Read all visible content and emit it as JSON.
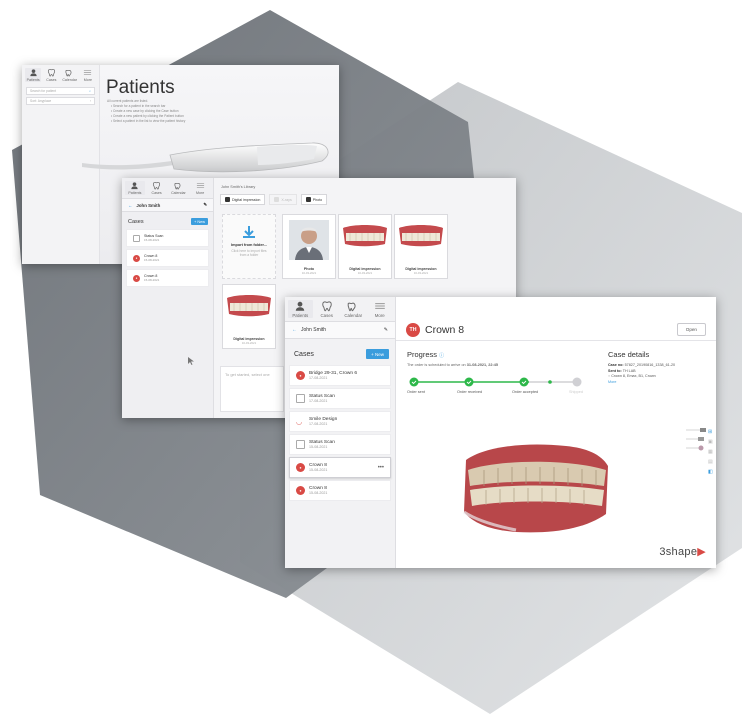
{
  "win1": {
    "title": "Patients",
    "tabs": [
      "Patients",
      "Cases",
      "Calendar",
      "More"
    ],
    "search_placeholder": "Search for patient",
    "sort_label": "Sort: Anyplace",
    "intro": "All current patients are listed.",
    "bullets": [
      "• Search for a patient in the search bar",
      "• Create a new case by clicking the Case button",
      "• Create a new patient by clicking the Patient button",
      "• Select a patient in the list to view the patient history"
    ]
  },
  "win2": {
    "tabs": [
      "Patients",
      "Cases",
      "Calendar",
      "More"
    ],
    "patient_name": "John Smith",
    "cases_heading": "Cases",
    "new_button": "+ New",
    "cases": [
      {
        "name": "Status Scan",
        "date": "15-08-2021",
        "type": "scan"
      },
      {
        "name": "Crown 8",
        "date": "15-08-2021",
        "type": "crown"
      },
      {
        "name": "Crown 8",
        "date": "15-08-2021",
        "type": "crown"
      }
    ],
    "library_title": "John Smith's Library",
    "filters": [
      {
        "label": "Digital impression",
        "on": true
      },
      {
        "label": "X-rays",
        "on": false
      },
      {
        "label": "Photo",
        "on": true
      }
    ],
    "import_title": "Import from folder...",
    "import_hint": "Click here to import files from a folder",
    "tiles": [
      {
        "label": "Photo",
        "date": "16-03-2021"
      },
      {
        "label": "Digital impression",
        "date": "16-03-2021"
      },
      {
        "label": "Digital impression",
        "date": "16-03-2021"
      },
      {
        "label": "Digital impression",
        "date": "16-03-2021"
      }
    ],
    "prompt": "To get started, select one"
  },
  "win3": {
    "tabs": [
      "Patients",
      "Cases",
      "Calendar",
      "More"
    ],
    "patient_name": "John Smith",
    "cases_heading": "Cases",
    "new_button": "+ New",
    "cases": [
      {
        "name": "Bridge 29-31, Crown 6",
        "date": "17-08-2021",
        "type": "crown"
      },
      {
        "name": "Status Scan",
        "date": "17-08-2021",
        "type": "scan"
      },
      {
        "name": "Smile Design",
        "date": "17-08-2021",
        "type": "smile"
      },
      {
        "name": "Status Scan",
        "date": "15-08-2021",
        "type": "scan"
      },
      {
        "name": "Crown 8",
        "date": "15-08-2021",
        "type": "crown"
      },
      {
        "name": "Crown 8",
        "date": "15-08-2021",
        "type": "crown"
      }
    ],
    "case_initials": "TH",
    "case_title": "Crown 8",
    "open_button": "Open",
    "progress_heading": "Progress",
    "progress_text_prefix": "The order is scheduled to arrive on ",
    "progress_date": "31-08-2021, 22:45",
    "steps": [
      {
        "label": "Order sent",
        "done": true
      },
      {
        "label": "Order received",
        "done": true
      },
      {
        "label": "Order accepted",
        "done": true
      },
      {
        "label": "Shipped",
        "done": false
      }
    ],
    "details_heading": "Case details",
    "case_no_label": "Case no:",
    "case_no": "57827_20190816_1338_61-20",
    "sent_to_label": "Sent to:",
    "sent_to": "TH LAB",
    "items": "Crown 8, Emax, B1, Crown",
    "more_link": "More",
    "brand": "3shape"
  },
  "colors": {
    "accent": "#3b9ddd",
    "progress_green": "#2db84a",
    "case_red": "#d94a45",
    "hex_dark": "#7a7f84",
    "hex_light": "#cfd2d5"
  }
}
